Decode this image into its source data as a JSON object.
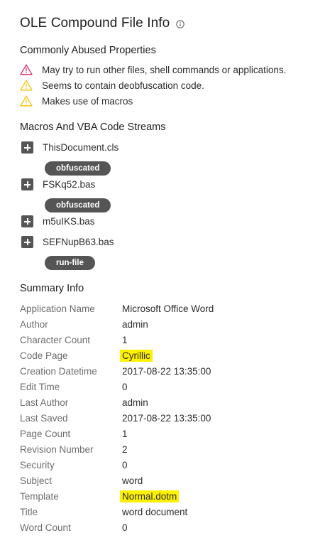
{
  "header": {
    "title": "OLE Compound File Info",
    "info_icon": "info-circle-icon"
  },
  "abused_properties": {
    "heading": "Commonly Abused Properties",
    "items": [
      {
        "text": "May try to run other files, shell commands or applications.",
        "icon": "warning-triangle-icon",
        "severity": "high",
        "color": "#e0245e"
      },
      {
        "text": "Seems to contain deobfuscation code.",
        "icon": "warning-triangle-icon",
        "severity": "medium",
        "color": "#f2c200"
      },
      {
        "text": "Makes use of macros",
        "icon": "warning-triangle-icon",
        "severity": "medium",
        "color": "#f2c200"
      }
    ]
  },
  "macros": {
    "heading": "Macros And VBA Code Streams",
    "streams": [
      {
        "name": "ThisDocument.cls",
        "tag": "obfuscated"
      },
      {
        "name": "FSKq52.bas",
        "tag": "obfuscated"
      },
      {
        "name": "m5uIKS.bas",
        "tag": ""
      },
      {
        "name": "SEFNupB63.bas",
        "tag": "run-file"
      }
    ]
  },
  "summary": {
    "heading": "Summary Info",
    "rows": [
      {
        "key": "Application Name",
        "value": "Microsoft Office Word",
        "highlight": false
      },
      {
        "key": "Author",
        "value": "admin",
        "highlight": false
      },
      {
        "key": "Character Count",
        "value": "1",
        "highlight": false
      },
      {
        "key": "Code Page",
        "value": "Cyrillic",
        "highlight": true
      },
      {
        "key": "Creation Datetime",
        "value": "2017-08-22 13:35:00",
        "highlight": false
      },
      {
        "key": "Edit Time",
        "value": "0",
        "highlight": false
      },
      {
        "key": "Last Author",
        "value": "admin",
        "highlight": false
      },
      {
        "key": "Last Saved",
        "value": "2017-08-22 13:35:00",
        "highlight": false
      },
      {
        "key": "Page Count",
        "value": "1",
        "highlight": false
      },
      {
        "key": "Revision Number",
        "value": "2",
        "highlight": false
      },
      {
        "key": "Security",
        "value": "0",
        "highlight": false
      },
      {
        "key": "Subject",
        "value": "word",
        "highlight": false
      },
      {
        "key": "Template",
        "value": "Normal.dotm",
        "highlight": true
      },
      {
        "key": "Title",
        "value": "word document",
        "highlight": false
      },
      {
        "key": "Word Count",
        "value": "0",
        "highlight": false
      }
    ]
  },
  "colors": {
    "highlight": "#fff200",
    "tag_bg": "#555555",
    "warning_high": "#e0245e",
    "warning_medium": "#f2c200"
  }
}
